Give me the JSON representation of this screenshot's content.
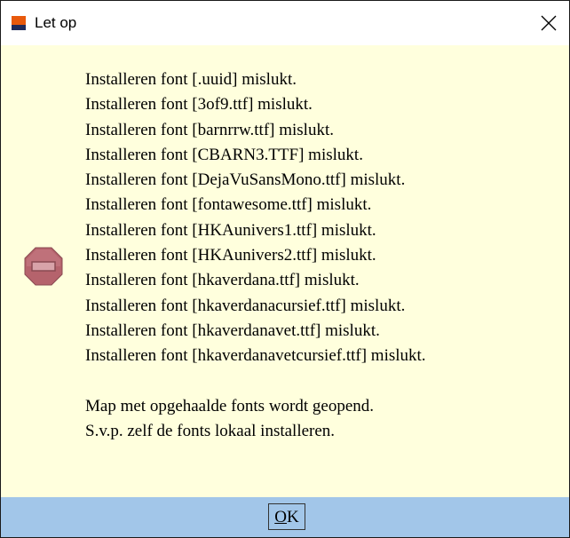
{
  "window": {
    "title": "Let op",
    "close_symbol": "×"
  },
  "icons": {
    "app_icon": "app-icon",
    "message_icon": "stop-sign-icon",
    "close_icon": "close-icon"
  },
  "message": {
    "lines": [
      "Installeren font [.uuid] mislukt.",
      "Installeren font [3of9.ttf] mislukt.",
      "Installeren font [barnrrw.ttf] mislukt.",
      "Installeren font [CBARN3.TTF] mislukt.",
      "Installeren font [DejaVuSansMono.ttf] mislukt.",
      "Installeren font [fontawesome.ttf] mislukt.",
      "Installeren font [HKAunivers1.ttf] mislukt.",
      "Installeren font [HKAunivers2.ttf] mislukt.",
      "Installeren font [hkaverdana.ttf] mislukt.",
      "Installeren font [hkaverdanacursief.ttf] mislukt.",
      "Installeren font [hkaverdanavet.ttf] mislukt.",
      "Installeren font [hkaverdanavetcursief.ttf] mislukt."
    ],
    "footer_lines": [
      "Map met opgehaalde fonts wordt geopend.",
      "S.v.p. zelf de fonts lokaal installeren."
    ]
  },
  "buttons": {
    "ok_accel": "O",
    "ok_rest": "K"
  },
  "colors": {
    "content_background": "#ffffdd",
    "footer_background": "#a2c6e9",
    "stop_sign": "#b5636c"
  }
}
